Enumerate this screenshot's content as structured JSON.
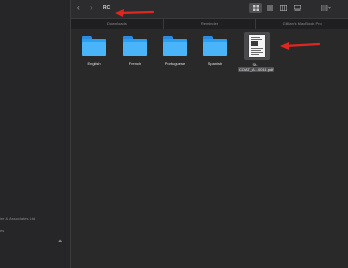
{
  "window": {
    "folder_title": "RC",
    "tabs": [
      "Downloads",
      "Reminder",
      "Gillian's MacBook Pro"
    ]
  },
  "sidebar": {
    "items": [
      {
        "label": "ire & Associates Ltd"
      },
      {
        "label": "es"
      }
    ]
  },
  "files": {
    "folders": [
      {
        "name": "English"
      },
      {
        "name": "French"
      },
      {
        "name": "Portuguese"
      },
      {
        "name": "Spanish"
      }
    ],
    "pdf": {
      "name_line1": "St-",
      "name_line2": "COAT_A...0011.pdf"
    }
  },
  "annotations": {
    "arrow_color": "#e0271f"
  },
  "colors": {
    "folder": "#2c9ff0",
    "background": "#29292a",
    "sidebar": "#262628"
  }
}
